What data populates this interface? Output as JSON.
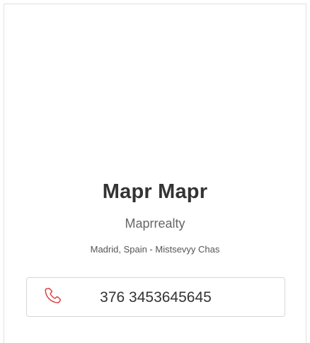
{
  "profile": {
    "name": "Mapr Mapr",
    "company": "Maprrealty",
    "location": "Madrid, Spain - Mistsevyy Chas"
  },
  "contact": {
    "phone": "376 3453645645",
    "icon": "phone-icon",
    "icon_color": "#d9383a"
  }
}
